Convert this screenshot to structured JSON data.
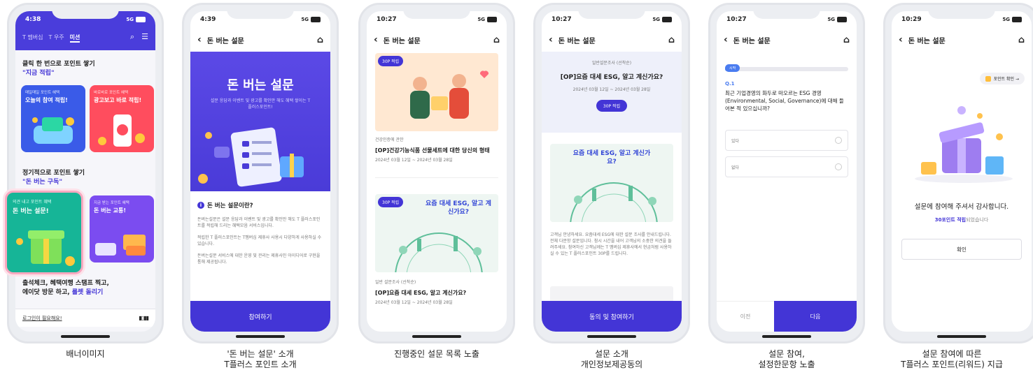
{
  "phone1": {
    "time": "4:38",
    "network": "5G",
    "tabs": [
      "T 멤버십",
      "T 우주",
      "미션"
    ],
    "section1_title": "클릭 한 번으로 포인트 쌓기",
    "section1_highlight": "\"지금 적립\"",
    "card1_tag": "매일매일 포인트 혜택",
    "card1_title": "오늘의 참여 적립!",
    "card2_tag": "바로바로 포인트 혜택",
    "card2_title": "광고보고 바로 적립!",
    "section2_title": "정기적으로 포인트 쌓기",
    "section2_highlight": "\"돈 버는 구독\"",
    "card3_tag": "의견 내고 포인트 혜택",
    "card3_title": "돈 버는 설문!",
    "card4_tag": "지금 받는 포인트 혜택",
    "card4_title": "돈 버는 교통!",
    "section3_line1": "출석체크, 혜택여행 스탬프 찍고,",
    "section3_line2_pre": "에이닷 방문 하고, ",
    "section3_line2_hl": "룰렛 돌리기",
    "login_notice": "로그인이 필요해요!",
    "caption": "배너이미지"
  },
  "phone2": {
    "time": "4:39",
    "network": "5G",
    "nav_title": "돈 버는 설문",
    "hero_title": "돈 버는 설문",
    "hero_sub": "설문 응답과 이벤트 및 광고를 확인만 해도 혜택 쌓이는 T 플러스포인트!",
    "info_title": "돈 버는 설문이란?",
    "bullet1": "돈버는설문은 설문 응답과 이벤트 및 광고를 확인만 해도 T 플러스포인트를 적립해 드리는 혜택모음 서비스입니다.",
    "bullet2": "적립한 T 플러스포인트는 T멤버십 제휴사 사용시 다양하게 사용하실 수 있습니다.",
    "bullet3": "돈버는설문 서비스에 대한 운영 및 관리는 제휴사인 아이디어로 구현을 통해 제공됩니다.",
    "button": "참여하기",
    "caption_line1": "'돈 버는 설문' 소개",
    "caption_line2": "T플러스 포인트 소개"
  },
  "phone3": {
    "time": "10:27",
    "network": "5G",
    "nav_title": "돈 버는 설문",
    "badge": "30P 적립",
    "item1_meta": "건강인증에 관한",
    "item1_title": "[OP]건강기능식품 선물세트에 대한 당신의 형태",
    "item1_date": "2024년 03월 12일 ~ 2024년 03월 28일",
    "item2_banner": "요즘 대세 ESG, 알고 계신가요?",
    "item2_meta": "일반 설문조사 (선착순)",
    "item2_title": "[OP]요즘 대세 ESG, 알고 계신가요?",
    "item2_date": "2024년 03월 12일 ~ 2024년 03월 28일",
    "caption": "진행중인 설문 목록 노출"
  },
  "phone4": {
    "time": "10:27",
    "network": "5G",
    "nav_title": "돈 버는 설문",
    "sub": "일반설문조사 (선착순)",
    "title": "[OP]요즘 대세 ESG, 알고 계신가요?",
    "date": "2024년 03월 12일 ~ 2024년 03월 28일",
    "badge": "30P 적립",
    "banner_title": "요즘 대세 ESG, 알고 계신가요?",
    "body": "고객님 안녕하세요. 요즘대세 ESG에 대한 설문 조사를 안내드립니다. 전체 다문항 설문입니다. 참시 시간을 내어 고객님의 소중한 의견을 들려주세요. 참여하신 고객님께는 T 멤버십 제휴사에서 현금처럼 사용하실 수 있는 T 플러스포인트 30P를 드립니다.",
    "button": "동의 및 참여하기",
    "caption_line1": "설문 소개",
    "caption_line2": "개인정보제공동의"
  },
  "phone5": {
    "time": "10:27",
    "network": "5G",
    "nav_title": "돈 버는 설문",
    "progress_label": "시작",
    "progress": 0.1,
    "q_no": "Q.1",
    "question": "최근 기업경영의 화두로 떠오르는 ESG 경영 (Environmental, Social, Governance)에 대해 들어본 적 있으십니까?",
    "option1": "있다",
    "option2": "없다",
    "prev": "이전",
    "next": "다음",
    "caption_line1": "설문 참여,",
    "caption_line2": "설정한문항 노출"
  },
  "phone6": {
    "time": "10:29",
    "network": "5G",
    "nav_title": "돈 버는 설문",
    "point_check": "포인트 확인 →",
    "thanks": "설문에 참여해 주셔서 감사합니다.",
    "reward_pre": "30포인트 적립",
    "reward_post": "되었습니다",
    "confirm": "확인",
    "caption_line1": "설문 참여에 따른",
    "caption_line2": "T플러스 포인트(리워드) 지급"
  },
  "colors": {
    "brand": "#4335d6",
    "orange": "#ff6a3d",
    "green": "#1bb38a",
    "pink": "#f24b6a"
  }
}
